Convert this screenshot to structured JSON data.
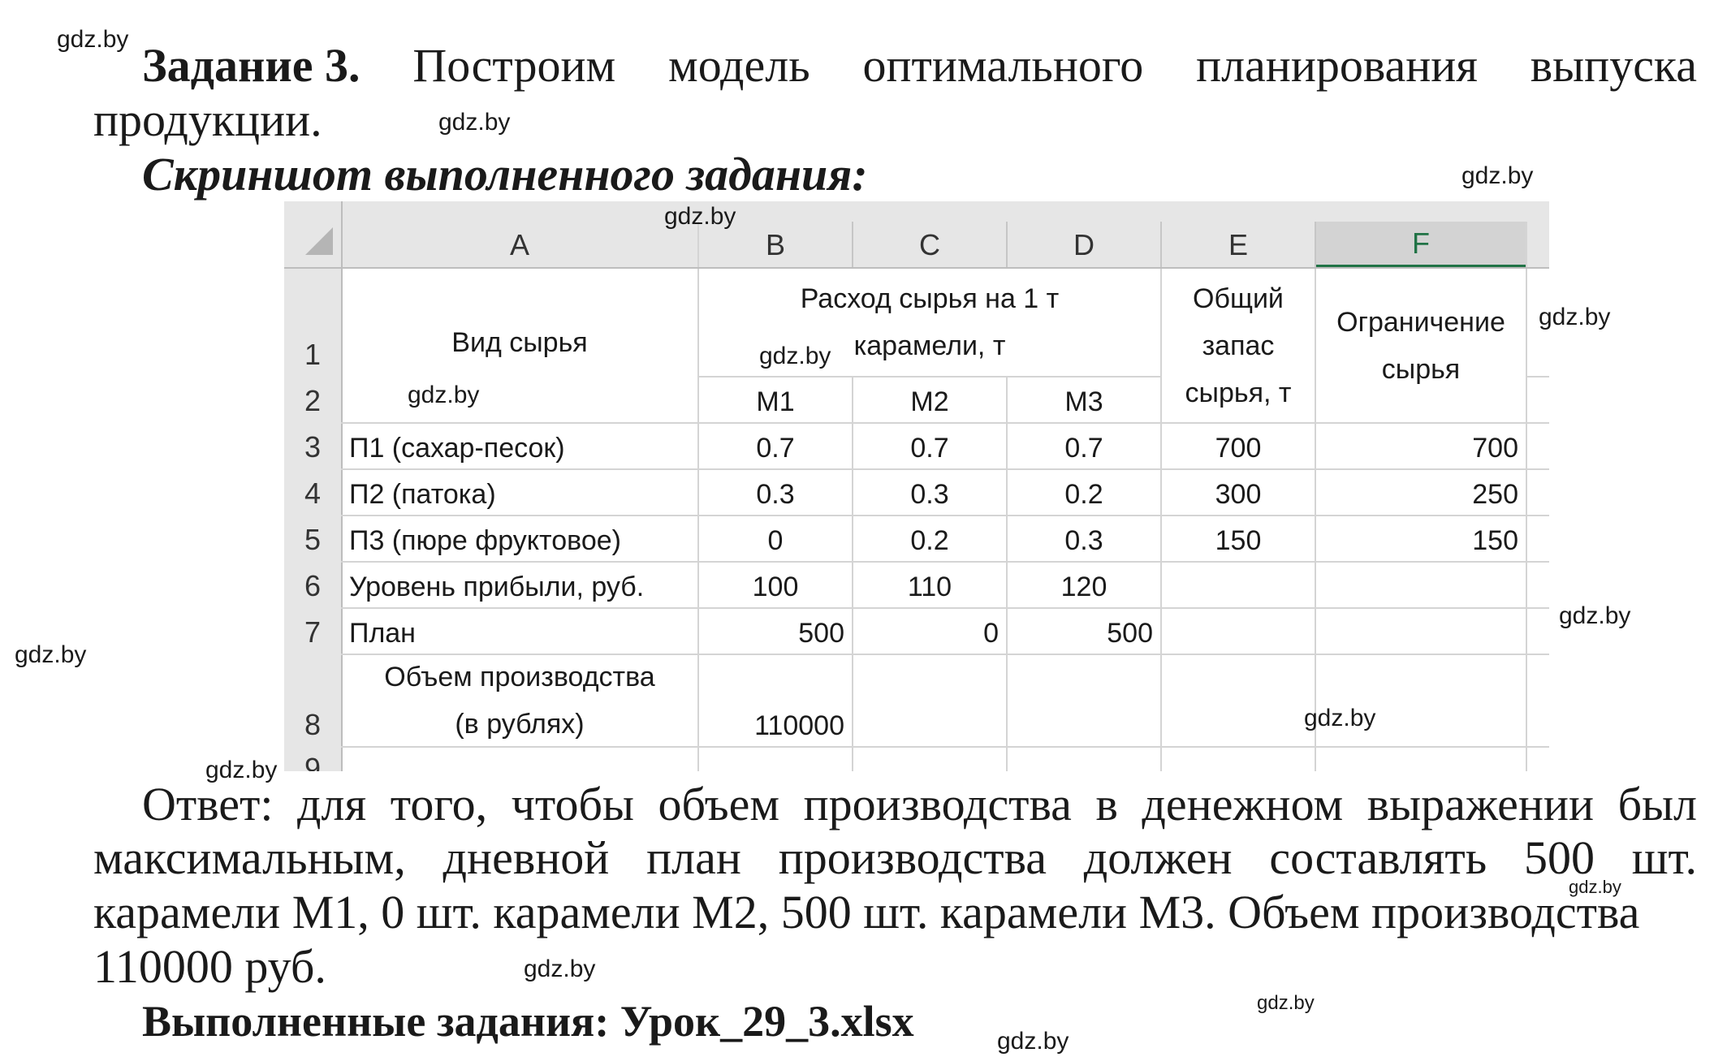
{
  "watermark": "gdz.by",
  "task": {
    "label": "Задание 3.",
    "words": [
      "Построим",
      "модель",
      "оптимального",
      "планирования",
      "выпуска"
    ],
    "line2": "продукции."
  },
  "screenshot_caption": "Скриншот выполненного задания:",
  "sheet": {
    "corner": "",
    "columns": [
      "A",
      "B",
      "C",
      "D",
      "E",
      "F"
    ],
    "rows": [
      "1",
      "2",
      "3",
      "4",
      "5",
      "6",
      "7",
      "8",
      "9"
    ],
    "header": {
      "vid_line1": "Вид сырья",
      "rashod_line1": "Расход сырья на 1 т",
      "rashod_line2": "карамели, т",
      "obshiy_line1": "Общий",
      "obshiy_line2": "запас",
      "obshiy_line3": "сырья, т",
      "ogr_line1": "Ограничение",
      "ogr_line2": "сырья",
      "m1": "М1",
      "m2": "М2",
      "m3": "М3"
    },
    "data_rows": [
      {
        "a": "П1 (сахар-песок)",
        "b": "0.7",
        "c": "0.7",
        "d": "0.7",
        "e": "700",
        "f": "700"
      },
      {
        "a": "П2 (патока)",
        "b": "0.3",
        "c": "0.3",
        "d": "0.2",
        "e": "300",
        "f": "250"
      },
      {
        "a": "П3 (пюре фруктовое)",
        "b": "0",
        "c": "0.2",
        "d": "0.3",
        "e": "150",
        "f": "150"
      },
      {
        "a": "Уровень прибыли, руб.",
        "b": "100",
        "c": "110",
        "d": "120",
        "e": "",
        "f": ""
      },
      {
        "a": "План",
        "b": "500",
        "c": "0",
        "d": "500",
        "e": "",
        "f": ""
      }
    ],
    "row8": {
      "a_line1": "Объем производства",
      "a_line2": "(в рублях)",
      "b": "110000"
    }
  },
  "answer": {
    "line1_words": [
      "Ответ:",
      "для",
      "того,",
      "чтобы",
      "объем",
      "производства",
      "в",
      "денежном",
      "выражении",
      "был"
    ],
    "line2_words": [
      "максимальным,",
      "дневной",
      "план",
      "производства",
      "должен",
      "составлять",
      "500",
      "шт."
    ],
    "line3": "карамели М1, 0 шт. карамели М2, 500 шт. карамели М3. Объем производства",
    "line4": "110000 руб."
  },
  "files": "Выполненные задания: Урок_29_3.xlsx"
}
